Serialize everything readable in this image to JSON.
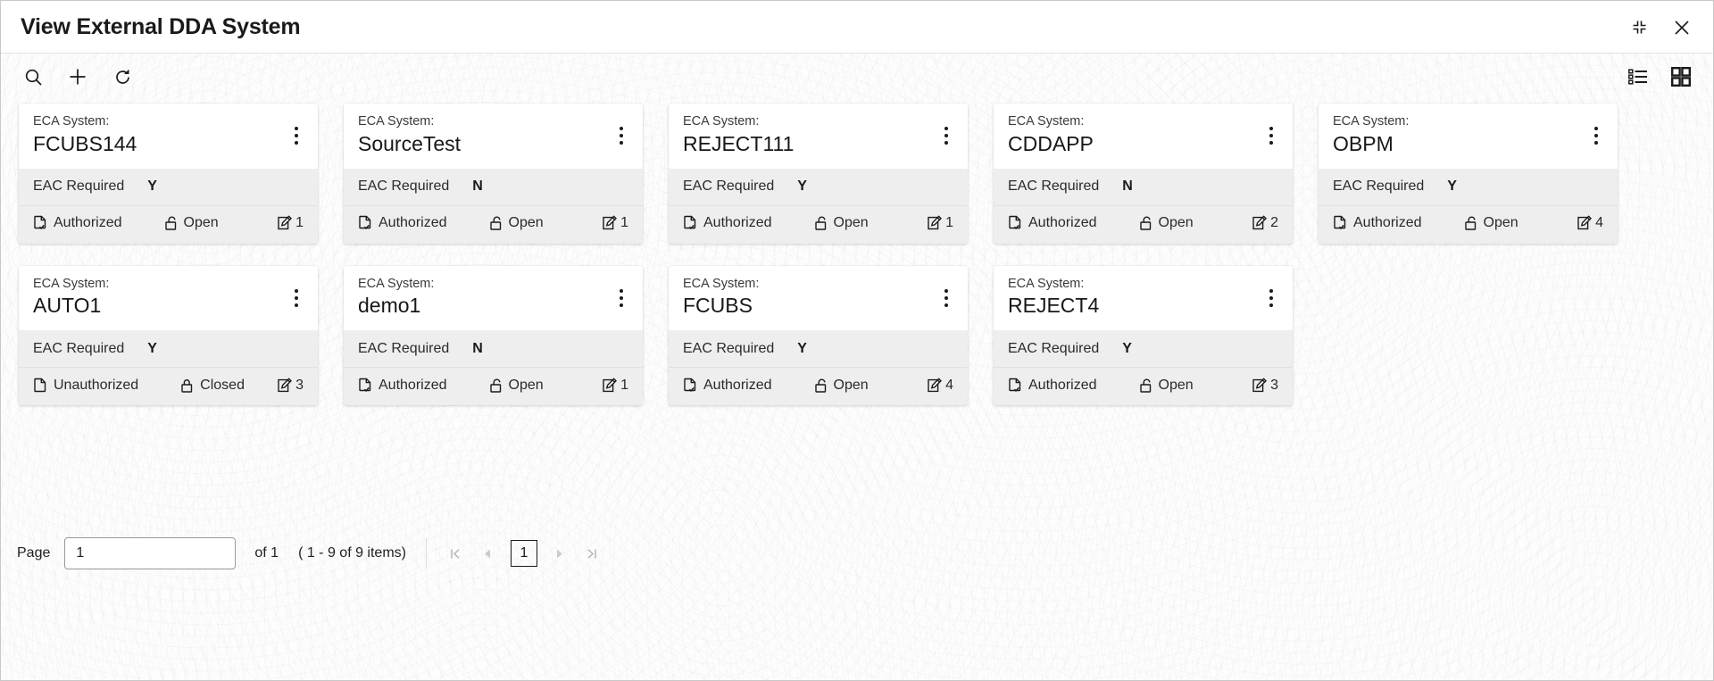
{
  "window": {
    "title": "View External DDA System",
    "actions": [
      {
        "name": "minimize-icon",
        "label": "Minimize"
      },
      {
        "name": "close-icon",
        "label": "Close"
      }
    ]
  },
  "toolbar": {
    "left": [
      {
        "name": "search-icon",
        "label": "Search"
      },
      {
        "name": "add-icon",
        "label": "Add"
      },
      {
        "name": "refresh-icon",
        "label": "Refresh"
      }
    ],
    "right": [
      {
        "name": "list-view-icon",
        "label": "List View"
      },
      {
        "name": "grid-view-icon",
        "label": "Grid View"
      }
    ]
  },
  "card_fields": {
    "title_label": "ECA System:",
    "body_label": "EAC Required"
  },
  "cards": [
    {
      "title_label": "ECA System:",
      "system": "FCUBS144",
      "body_label": "EAC Required",
      "eac_required": "Y",
      "auth_status": "Authorized",
      "auth_icon": "document-check-icon",
      "record_status": "Open",
      "record_icon": "padlock-open-icon",
      "mod_count": "1",
      "mod_icon": "edit-square-icon"
    },
    {
      "title_label": "ECA System:",
      "system": "SourceTest",
      "body_label": "EAC Required",
      "eac_required": "N",
      "auth_status": "Authorized",
      "auth_icon": "document-check-icon",
      "record_status": "Open",
      "record_icon": "padlock-open-icon",
      "mod_count": "1",
      "mod_icon": "edit-square-icon"
    },
    {
      "title_label": "ECA System:",
      "system": "REJECT111",
      "body_label": "EAC Required",
      "eac_required": "Y",
      "auth_status": "Authorized",
      "auth_icon": "document-check-icon",
      "record_status": "Open",
      "record_icon": "padlock-open-icon",
      "mod_count": "1",
      "mod_icon": "edit-square-icon"
    },
    {
      "title_label": "ECA System:",
      "system": "CDDAPP",
      "body_label": "EAC Required",
      "eac_required": "N",
      "auth_status": "Authorized",
      "auth_icon": "document-check-icon",
      "record_status": "Open",
      "record_icon": "padlock-open-icon",
      "mod_count": "2",
      "mod_icon": "edit-square-icon"
    },
    {
      "title_label": "ECA System:",
      "system": "OBPM",
      "body_label": "EAC Required",
      "eac_required": "Y",
      "auth_status": "Authorized",
      "auth_icon": "document-check-icon",
      "record_status": "Open",
      "record_icon": "padlock-open-icon",
      "mod_count": "4",
      "mod_icon": "edit-square-icon"
    },
    {
      "title_label": "ECA System:",
      "system": "AUTO1",
      "body_label": "EAC Required",
      "eac_required": "Y",
      "auth_status": "Unauthorized",
      "auth_icon": "document-icon",
      "record_status": "Closed",
      "record_icon": "padlock-closed-icon",
      "mod_count": "3",
      "mod_icon": "edit-square-icon"
    },
    {
      "title_label": "ECA System:",
      "system": "demo1",
      "body_label": "EAC Required",
      "eac_required": "N",
      "auth_status": "Authorized",
      "auth_icon": "document-check-icon",
      "record_status": "Open",
      "record_icon": "padlock-open-icon",
      "mod_count": "1",
      "mod_icon": "edit-square-icon"
    },
    {
      "title_label": "ECA System:",
      "system": "FCUBS",
      "body_label": "EAC Required",
      "eac_required": "Y",
      "auth_status": "Authorized",
      "auth_icon": "document-check-icon",
      "record_status": "Open",
      "record_icon": "padlock-open-icon",
      "mod_count": "4",
      "mod_icon": "edit-square-icon"
    },
    {
      "title_label": "ECA System:",
      "system": "REJECT4",
      "body_label": "EAC Required",
      "eac_required": "Y",
      "auth_status": "Authorized",
      "auth_icon": "document-check-icon",
      "record_status": "Open",
      "record_icon": "padlock-open-icon",
      "mod_count": "3",
      "mod_icon": "edit-square-icon"
    }
  ],
  "pagination": {
    "page_label": "Page",
    "page_value": "1",
    "of_text": "of 1",
    "items_text": "( 1 - 9 of 9 items)",
    "current_page": "1",
    "buttons": [
      {
        "name": "first-page-icon",
        "label": "First"
      },
      {
        "name": "prev-page-icon",
        "label": "Previous"
      },
      {
        "name": "next-page-icon",
        "label": "Next"
      },
      {
        "name": "last-page-icon",
        "label": "Last"
      }
    ]
  },
  "colors": {
    "card_header_bg": "#ffffff",
    "card_body_bg": "#eeeeee",
    "canvas_bg": "#fdfdfd",
    "text": "#1a1a1a",
    "disabled": "#b5b5b5"
  }
}
